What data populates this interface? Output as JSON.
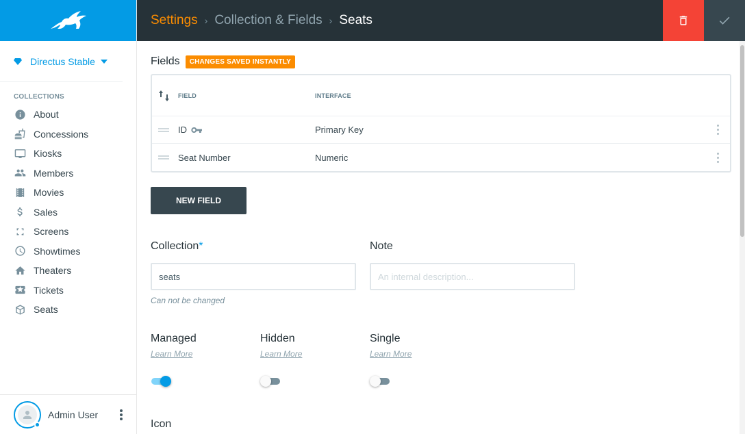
{
  "header": {
    "breadcrumb": [
      "Settings",
      "Collection & Fields",
      "Seats"
    ],
    "separator": "›"
  },
  "sidebar": {
    "project_name": "Directus Stable",
    "collections_heading": "COLLECTIONS",
    "items": [
      {
        "label": "About",
        "icon": "info-icon"
      },
      {
        "label": "Concessions",
        "icon": "fastfood-icon"
      },
      {
        "label": "Kiosks",
        "icon": "monitor-icon"
      },
      {
        "label": "Members",
        "icon": "people-icon"
      },
      {
        "label": "Movies",
        "icon": "film-icon"
      },
      {
        "label": "Sales",
        "icon": "dollar-icon"
      },
      {
        "label": "Screens",
        "icon": "fullscreen-icon"
      },
      {
        "label": "Showtimes",
        "icon": "clock-icon"
      },
      {
        "label": "Theaters",
        "icon": "home-icon"
      },
      {
        "label": "Tickets",
        "icon": "ticket-icon"
      },
      {
        "label": "Seats",
        "icon": "box-icon"
      }
    ],
    "user_name": "Admin User"
  },
  "fields": {
    "title": "Fields",
    "badge": "CHANGES SAVED INSTANTLY",
    "columns": [
      "FIELD",
      "INTERFACE"
    ],
    "rows": [
      {
        "field": "ID",
        "interface": "Primary Key",
        "primary": true
      },
      {
        "field": "Seat Number",
        "interface": "Numeric",
        "primary": false
      }
    ],
    "new_field_label": "NEW FIELD"
  },
  "form": {
    "collection_label": "Collection",
    "required_mark": "*",
    "collection_value": "seats",
    "collection_hint": "Can not be changed",
    "note_label": "Note",
    "note_placeholder": "An internal description..."
  },
  "toggles": [
    {
      "label": "Managed",
      "link": "Learn More",
      "on": true
    },
    {
      "label": "Hidden",
      "link": "Learn More",
      "on": false
    },
    {
      "label": "Single",
      "link": "Learn More",
      "on": false
    }
  ],
  "icon_label": "Icon",
  "colors": {
    "accent": "#039be5",
    "header_bg": "#263238",
    "breadcrumb_active": "#fb8c00",
    "delete": "#f44336",
    "badge": "#fb8c00"
  }
}
